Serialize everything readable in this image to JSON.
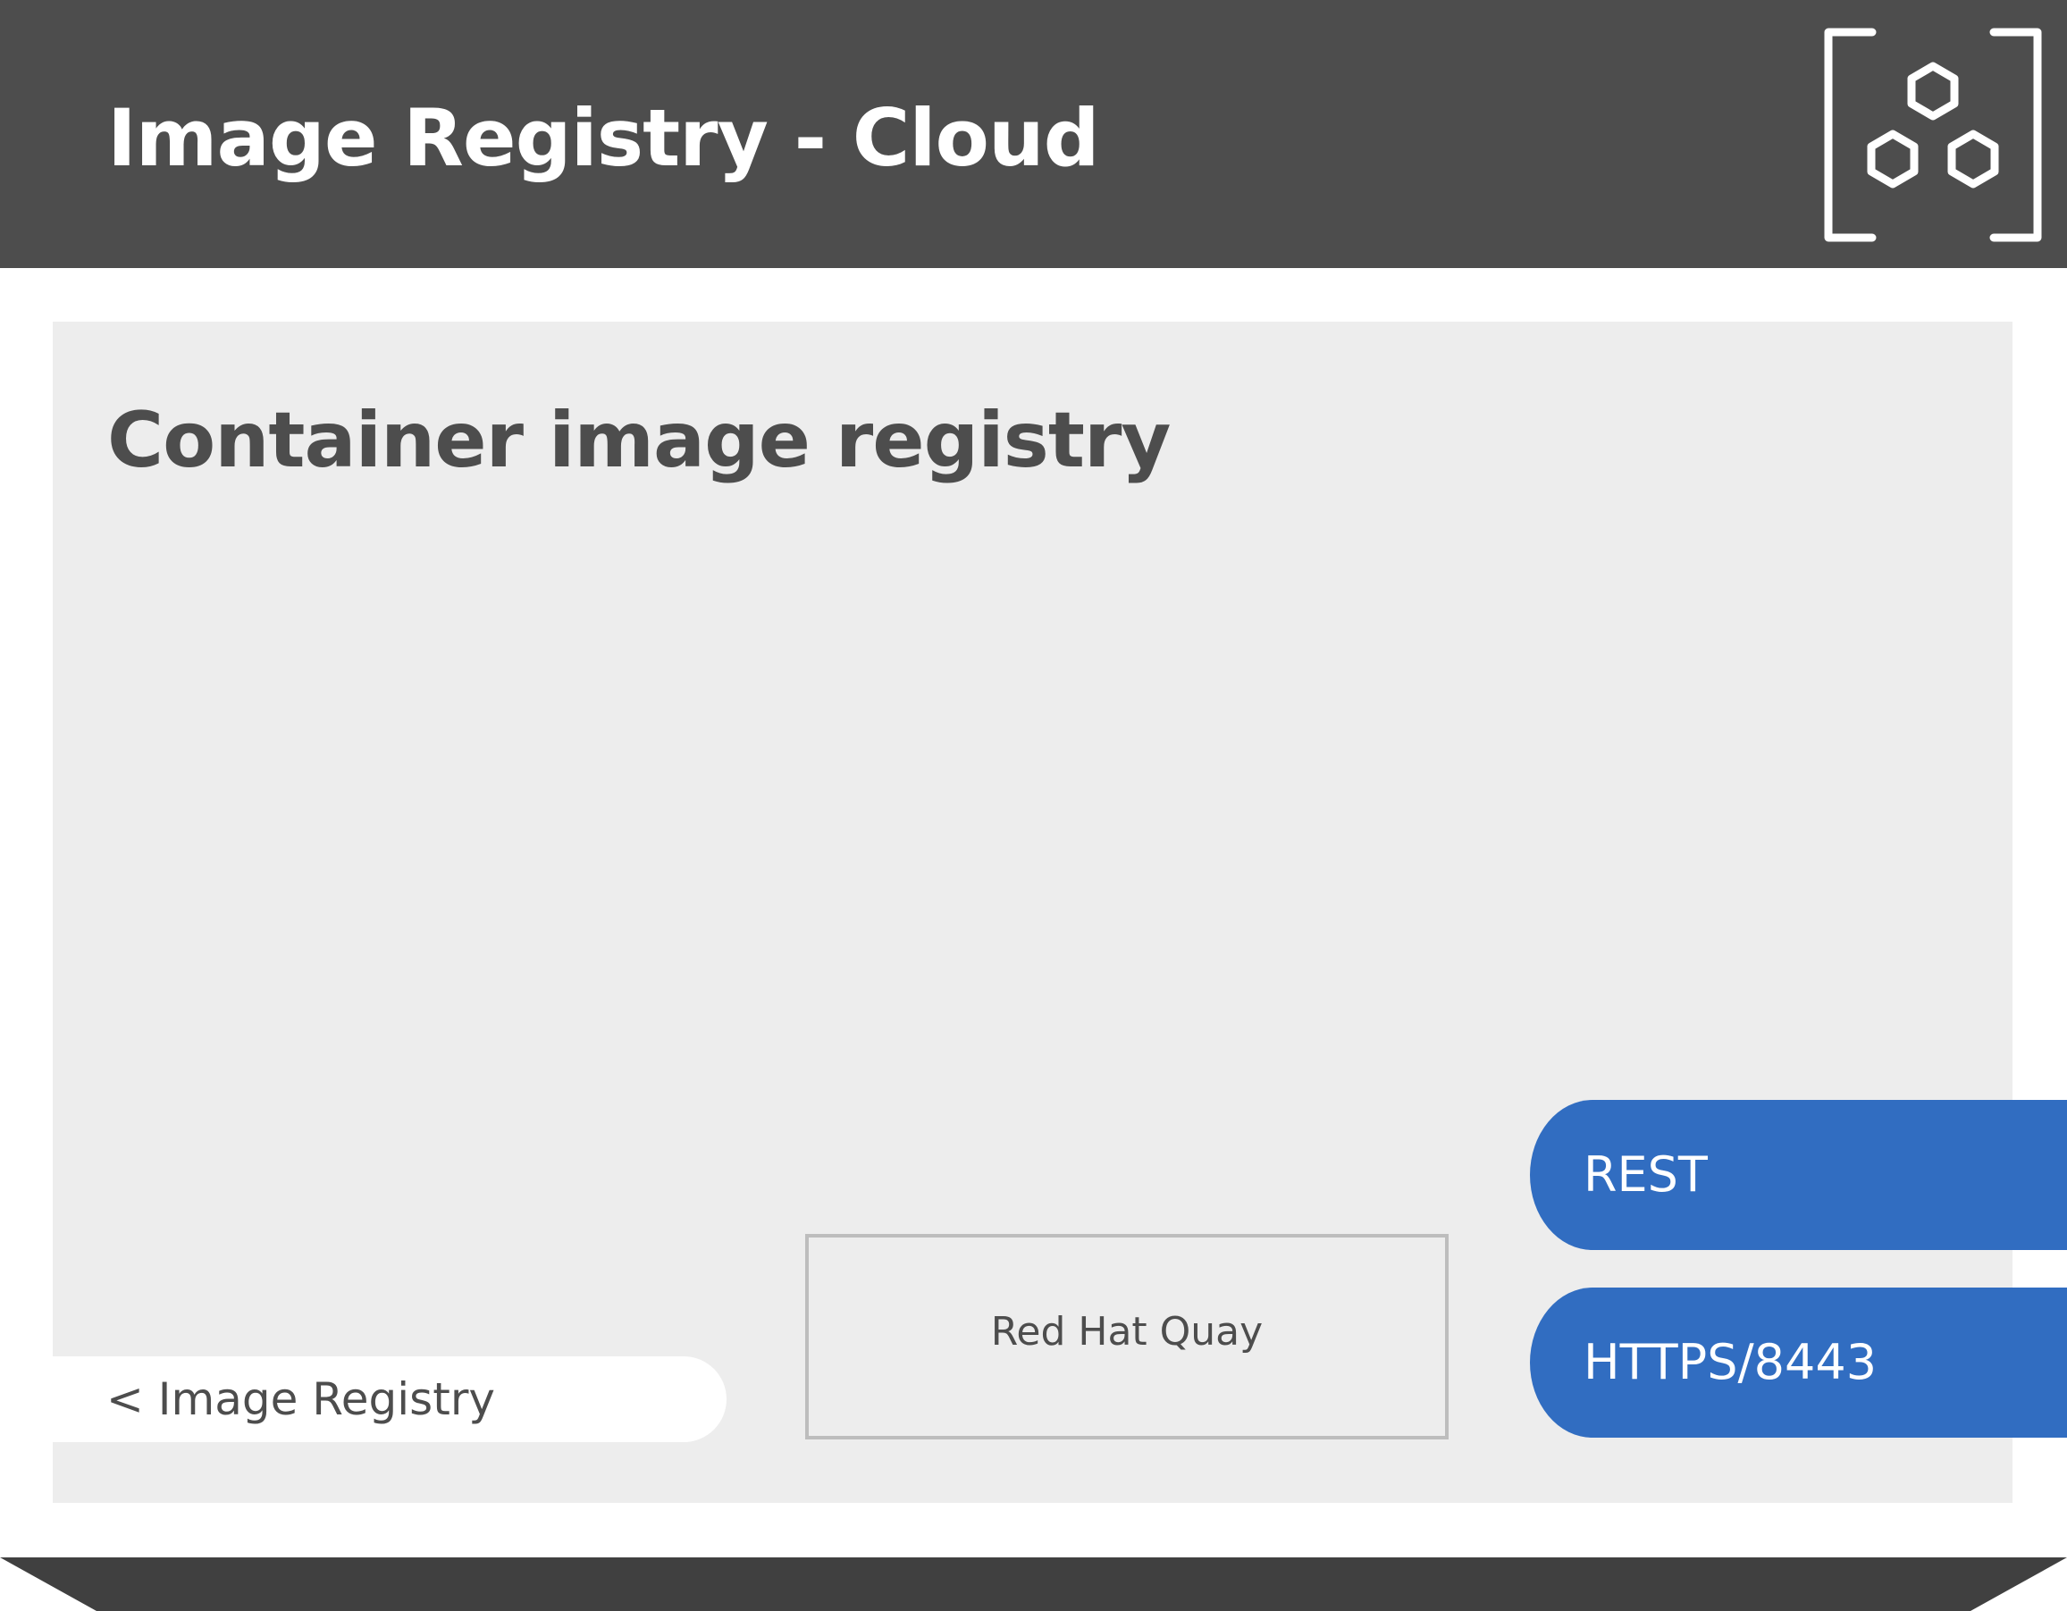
{
  "header": {
    "title": "Image Registry - Cloud",
    "icon": "container-hexagons-icon",
    "background_color": "#4d4d4d"
  },
  "panel": {
    "title": "Container image registry",
    "background_color": "#ededed"
  },
  "breadcrumb": {
    "label": "< Image Registry"
  },
  "component": {
    "label": "Red Hat Quay"
  },
  "endpoints": [
    {
      "label": "REST"
    },
    {
      "label": "HTTPS/8443"
    }
  ],
  "colors": {
    "endpoint": "#316dc1",
    "text_dark": "#4d4d4d",
    "footer": "#404040"
  }
}
